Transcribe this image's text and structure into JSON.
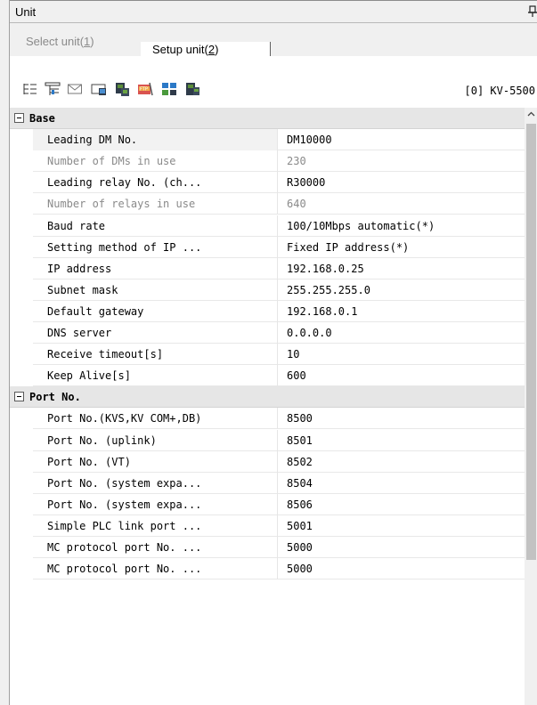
{
  "window": {
    "title": "Unit"
  },
  "tabs": [
    {
      "label": "Select unit(",
      "key": "1",
      "suffix": ")"
    },
    {
      "label": "Setup unit(",
      "key": "2",
      "suffix": ")"
    }
  ],
  "toolbar": {
    "icons": [
      "property-sort-icon",
      "category-sort-icon",
      "mail-icon",
      "unit-settings-icon",
      "module-copy-icon",
      "ftp-icon",
      "network-icon",
      "module-paste-icon"
    ],
    "unit_label": "[0] KV-5500"
  },
  "sections": [
    {
      "label": "Base",
      "rows": [
        {
          "name": "Leading DM No.",
          "value": "DM10000",
          "disabled": false,
          "selected": true
        },
        {
          "name": "Number of DMs in use",
          "value": "230",
          "disabled": true
        },
        {
          "name": "Leading relay No. (ch...",
          "value": "R30000",
          "disabled": false
        },
        {
          "name": "Number of relays in use",
          "value": "640",
          "disabled": true
        },
        {
          "name": "Baud rate",
          "value": "100/10Mbps automatic(*)",
          "disabled": false
        },
        {
          "name": "Setting method of IP ...",
          "value": "Fixed IP address(*)",
          "disabled": false
        },
        {
          "name": "IP address",
          "value": "192.168.0.25",
          "disabled": false
        },
        {
          "name": "Subnet mask",
          "value": "255.255.255.0",
          "disabled": false
        },
        {
          "name": "Default gateway",
          "value": "192.168.0.1",
          "disabled": false
        },
        {
          "name": "DNS server",
          "value": "0.0.0.0",
          "disabled": false
        },
        {
          "name": "Receive timeout[s]",
          "value": "10",
          "disabled": false
        },
        {
          "name": "Keep Alive[s]",
          "value": "600",
          "disabled": false
        }
      ]
    },
    {
      "label": "Port No.",
      "rows": [
        {
          "name": "Port No.(KVS,KV COM+,DB)",
          "value": "8500",
          "disabled": false
        },
        {
          "name": "Port No. (uplink)",
          "value": "8501",
          "disabled": false
        },
        {
          "name": "Port No. (VT)",
          "value": "8502",
          "disabled": false
        },
        {
          "name": "Port No. (system expa...",
          "value": "8504",
          "disabled": false
        },
        {
          "name": "Port No. (system expa...",
          "value": "8506",
          "disabled": false
        },
        {
          "name": "Simple PLC link port ...",
          "value": "5001",
          "disabled": false
        },
        {
          "name": "MC protocol port No. ...",
          "value": "5000",
          "disabled": false
        },
        {
          "name": "MC protocol port No. ...",
          "value": "5000",
          "disabled": false
        }
      ]
    }
  ],
  "colors": {
    "category_bg": "#e6e6e6",
    "disabled_text": "#8a8a8a",
    "scroll_thumb": "#c2c2c2"
  }
}
